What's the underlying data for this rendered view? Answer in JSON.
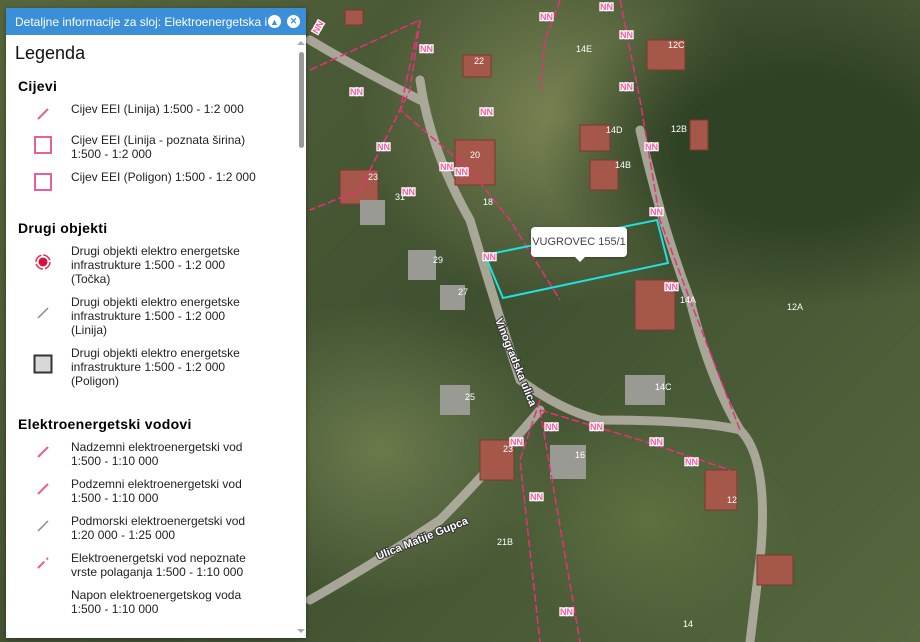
{
  "panel": {
    "title": "Detaljne informacije za sloj: Elektroenergetska i...",
    "heading": "Legenda",
    "sections": [
      {
        "title": "Cijevi",
        "items": [
          "Cijev EEI (Linija) 1:500 - 1:2 000",
          "Cijev EEI (Linija - poznata širina) 1:500 - 1:2 000",
          "Cijev EEI (Poligon) 1:500 - 1:2 000"
        ]
      },
      {
        "title": "Drugi objekti",
        "items": [
          "Drugi objekti elektro energetske infrastrukture 1:500 - 1:2 000 (Točka)",
          "Drugi objekti elektro energetske infrastrukture 1:500 - 1:2 000 (Linija)",
          "Drugi objekti elektro energetske infrastrukture 1:500 - 1:2 000 (Poligon)"
        ]
      },
      {
        "title": "Elektroenergetski vodovi",
        "items": [
          "Nadzemni elektroenergetski vod 1:500 - 1:10 000",
          "Podzemni elektroenergetski vod 1:500 - 1:10 000",
          "Podmorski elektroenergetski vod 1:20 000 - 1:25 000",
          "Elektroenergetski vod nepoznate vrste polaganja 1:500 - 1:10 000",
          "Napon elektroenergetskog voda 1:500 - 1:10 000"
        ]
      }
    ]
  },
  "map": {
    "tooltip": "VUGROVEC 155/1",
    "streets": [
      "Vinogradska ulica",
      "Ulica Matije Gupca"
    ],
    "line_label": "NN",
    "house_numbers": [
      "22",
      "14E",
      "12C",
      "14D",
      "12B",
      "14B",
      "20",
      "18",
      "31",
      "29",
      "27",
      "14A",
      "14C",
      "25",
      "16",
      "12",
      "21B",
      "12A",
      "14"
    ]
  },
  "colors": {
    "header": "#3a8fd8",
    "line": "#e8307a",
    "parcel": "#20e0e0"
  }
}
